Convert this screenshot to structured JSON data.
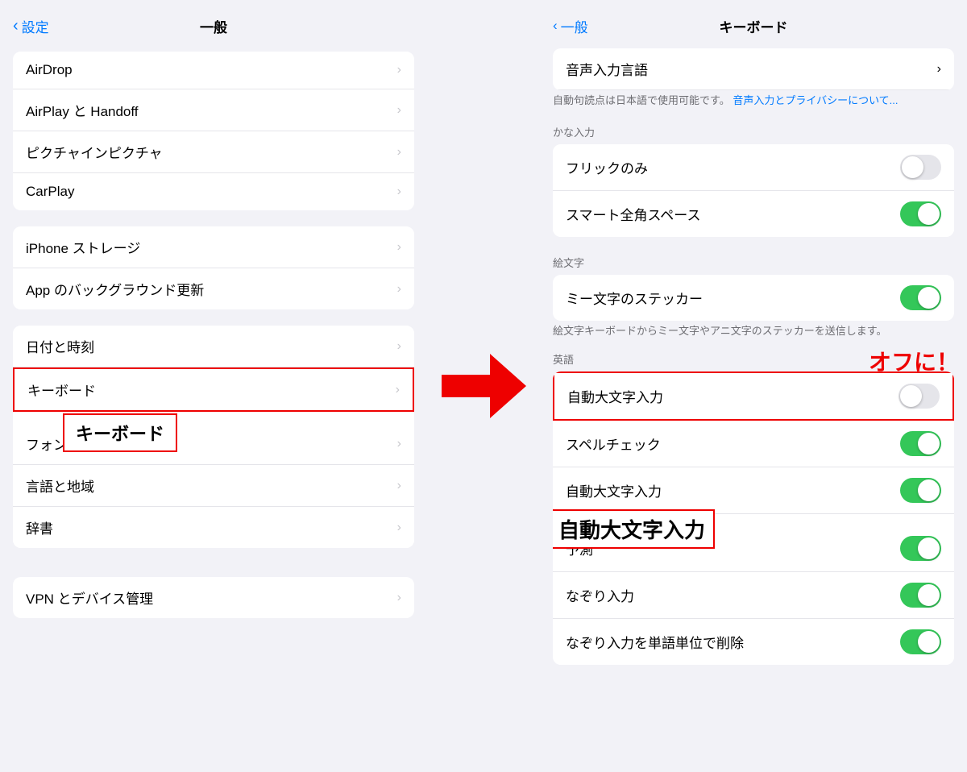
{
  "left": {
    "nav": {
      "back_label": "設定",
      "title": "一般"
    },
    "groups": [
      {
        "items": [
          {
            "label": "AirDrop"
          },
          {
            "label": "AirPlay と Handoff"
          },
          {
            "label": "ピクチャインピクチャ"
          },
          {
            "label": "CarPlay"
          }
        ]
      },
      {
        "items": [
          {
            "label": "iPhone ストレージ"
          },
          {
            "label": "App のバックグラウンド更新"
          }
        ]
      },
      {
        "items": [
          {
            "label": "日付と時刻"
          },
          {
            "label": "キーボード",
            "highlighted": true
          },
          {
            "label": "フォント"
          },
          {
            "label": "言語と地域"
          },
          {
            "label": "辞書"
          }
        ]
      },
      {
        "items": [
          {
            "label": "VPN とデバイス管理"
          }
        ]
      }
    ],
    "annotation": {
      "keyboard_label": "キーボード"
    }
  },
  "right": {
    "nav": {
      "back_label": "一般",
      "title": "キーボード"
    },
    "partial_top": {
      "label": "音声入力言語"
    },
    "note": "自動句読点は日本語で使用可能です。",
    "note_link": "音声入力とプライバシーについて...",
    "sections": [
      {
        "header": "かな入力",
        "items": [
          {
            "label": "フリックのみ",
            "toggle": "off"
          },
          {
            "label": "スマート全角スペース",
            "toggle": "on"
          }
        ]
      },
      {
        "header": "絵文字",
        "items": [
          {
            "label": "ミー文字のステッカー",
            "toggle": "on"
          }
        ],
        "sub_note": "絵文字キーボードからミー文字やアニ文字のステッカーを送信します。"
      },
      {
        "header": "英語",
        "items": [
          {
            "label": "自動大文字入力",
            "toggle": "off",
            "highlighted": true
          },
          {
            "label": "スペルチェック",
            "toggle": "on"
          },
          {
            "label": "自動大文字入力",
            "toggle": "on",
            "annotation": true
          },
          {
            "label": "予測",
            "toggle": "on"
          },
          {
            "label": "なぞり入力",
            "toggle": "on"
          },
          {
            "label": "なぞり入力を単語単位で削除",
            "toggle": "on"
          }
        ]
      }
    ],
    "annotation": {
      "offni_label": "オフに！",
      "auto_label": "自動大文字入力"
    }
  }
}
